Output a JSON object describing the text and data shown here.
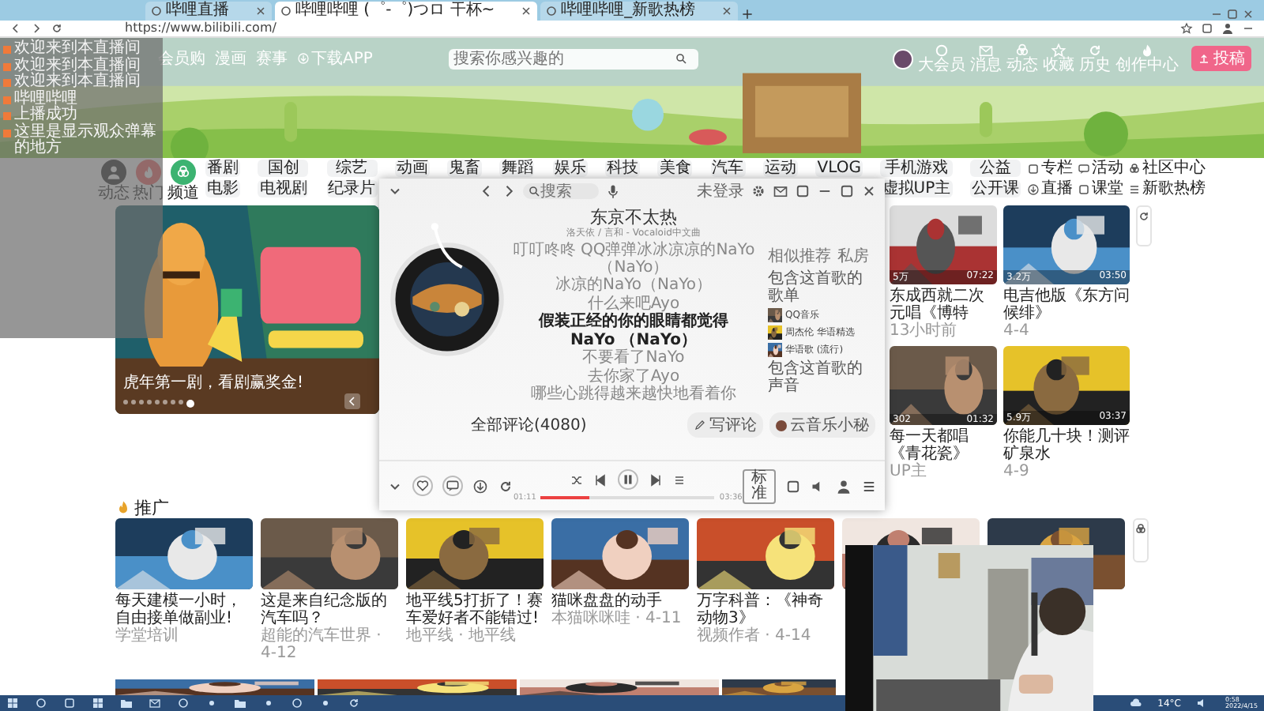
{
  "browser": {
    "tabs": [
      {
        "title": "哔哩直播",
        "selected": false
      },
      {
        "title": "哔哩哔哩 (゜-゜)つロ 干杯~",
        "selected": true
      },
      {
        "title": "哔哩哔哩_新歌热榜",
        "selected": false
      }
    ],
    "address": "https://www.bilibili.com/"
  },
  "header": {
    "nav": [
      "会员购",
      "漫画",
      "赛事",
      "下载APP"
    ],
    "search": {
      "placeholder": "搜索你感兴趣的"
    },
    "user_links": [
      "大会员",
      "消息",
      "动态",
      "收藏",
      "历史",
      "创作中心"
    ],
    "upload_button": "投稿"
  },
  "channels": {
    "shortcuts": [
      {
        "label": "动态"
      },
      {
        "label": "热门"
      },
      {
        "label": "频道"
      }
    ],
    "row_1": [
      "番剧",
      "国创",
      "综艺",
      "动画",
      "鬼畜",
      "舞蹈",
      "娱乐",
      "科技",
      "美食",
      "汽车",
      "运动",
      "VLOG",
      "手机游戏",
      "公益"
    ],
    "row_2_left": [
      "电影",
      "电视剧",
      "纪录片"
    ],
    "row_2_right": [
      "虚拟UP主",
      "公开课"
    ],
    "links": [
      "专栏",
      "活动",
      "社区中心",
      "直播",
      "课堂",
      "新歌热榜"
    ]
  },
  "carousel": {
    "caption": "虎年第一剧，看剧赢奖金!",
    "dots": [
      {
        "selected": false
      },
      {
        "selected": false
      },
      {
        "selected": false
      },
      {
        "selected": false
      },
      {
        "selected": false
      },
      {
        "selected": false
      },
      {
        "selected": false
      },
      {
        "selected": false
      },
      {
        "selected": true
      }
    ]
  },
  "feed": [
    {
      "title": "东成西就二次元唱《博特",
      "author": "13小时前",
      "stats": [
        "5万",
        "07:22"
      ]
    },
    {
      "title": "电吉他版《东方问候绯》",
      "author": "4-4",
      "stats": [
        "3.2万",
        "03:50"
      ]
    },
    {
      "title": "每一天都唱《青花瓷》",
      "author": "UP主",
      "stats": [
        "302",
        "01:32"
      ]
    },
    {
      "title": "你能几十块！测评矿泉水",
      "author": "4-9",
      "stats": [
        "5.9万",
        "03:37"
      ]
    }
  ],
  "promo": {
    "title": "推广",
    "cards": [
      {
        "title": "每天建模一小时，自由接单做副业!",
        "author": "学堂培训"
      },
      {
        "title": "这是来自纪念版的汽车吗？",
        "author": "超能的汽车世界 · 4-12"
      },
      {
        "title": "地平线5打折了！赛车爱好者不能错过!",
        "author": "地平线 · 地平线"
      },
      {
        "title": "猫咪盘盘的动手",
        "author": "本猫咪咪哇 · 4-11"
      },
      {
        "title": "万字科普：《神奇动物3》",
        "author": "视频作者 · 4-14"
      },
      {
        "kind": "picture"
      },
      {
        "kind": "picture"
      }
    ]
  },
  "player": {
    "search": {
      "placeholder": "搜索"
    },
    "login": "未登录",
    "song": "东京不太热",
    "artist": "洛天依 / 言和 - Vocaloid中文曲",
    "lyrics": [
      {
        "text": "叮叮咚咚 QQ弹弹冰冰凉凉的NaYo（NaYo）",
        "current": false
      },
      {
        "text": "冰凉的NaYo（NaYo）",
        "current": false
      },
      {
        "text": "什么来吧Ayo",
        "current": false
      },
      {
        "text": "假装正经的你的眼睛都觉得",
        "current": true
      },
      {
        "text": "NaYo （NaYo）",
        "current": true
      },
      {
        "text": "不要看了NaYo",
        "current": false
      },
      {
        "text": "去你家了Ayo",
        "current": false
      },
      {
        "text": "哪些心跳得越来越快地看着你",
        "current": false
      }
    ],
    "side_tabs": [
      "相似推荐",
      "私房"
    ],
    "side_heading": "包含这首歌的歌单",
    "playlists": [
      "QQ音乐",
      "周杰伦 华语精选",
      "华语歌 (流行)"
    ],
    "side_footer": "包含这首歌的声音",
    "comments": "全部评论(4080)",
    "write_comment": "写评论",
    "assistant": "云音乐小秘",
    "elapsed": "01:11",
    "total": "03:36",
    "progress": {
      "level": 0.28
    },
    "quality": "标准"
  },
  "chat": {
    "messages": [
      "欢迎来到本直播间",
      "欢迎来到本直播间",
      "欢迎来到本直播间",
      "哔哩哔哩",
      "上播成功",
      "这里是显示观众弹幕的地方"
    ]
  },
  "taskbar": {
    "weather": "14°C",
    "time": "0:58",
    "date": "2022/4/15"
  }
}
